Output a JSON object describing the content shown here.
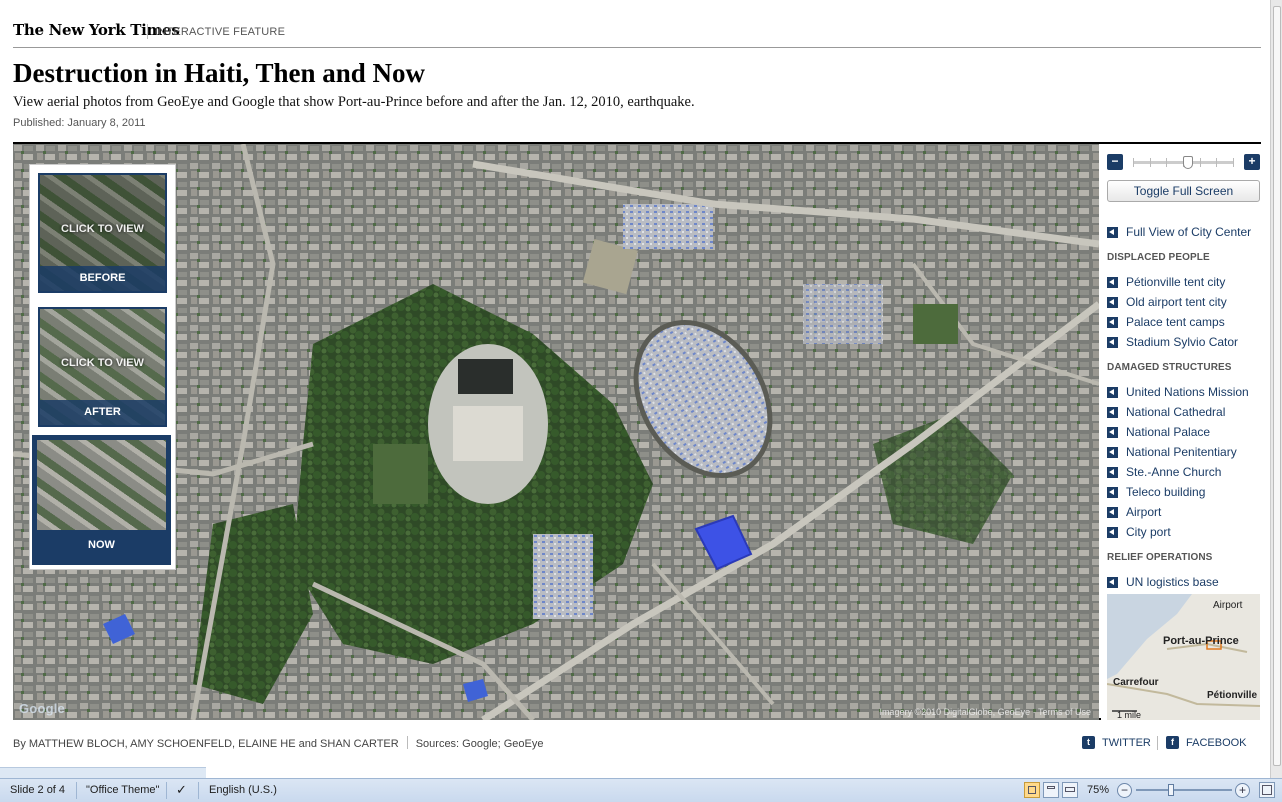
{
  "masthead": {
    "logo": "The New York Times",
    "section": "INTERACTIVE FEATURE"
  },
  "article": {
    "title": "Destruction in Haiti, Then and Now",
    "summary": "View aerial photos from GeoEye and Google that show Port-au-Prince before and after the Jan. 12, 2010, earthquake.",
    "published": "Published: January 8, 2011"
  },
  "viewer": {
    "thumbnails": [
      {
        "cta": "CLICK TO VIEW",
        "label": "BEFORE"
      },
      {
        "cta": "CLICK TO VIEW",
        "label": "AFTER"
      },
      {
        "cta": "",
        "label": "NOW"
      }
    ],
    "map_credit": "Imagery ©2010 DigitalGlobe, GeoEye · Terms of Use",
    "google_mark": "Google",
    "zoom_level": 0.55,
    "toggle_fullscreen": "Toggle Full Screen",
    "nav": {
      "full_view": "Full View of City Center",
      "groups": [
        {
          "heading": "DISPLACED PEOPLE",
          "items": [
            "Pétionville tent city",
            "Old airport tent city",
            "Palace tent camps",
            "Stadium Sylvio Cator"
          ]
        },
        {
          "heading": "DAMAGED STRUCTURES",
          "items": [
            "United Nations Mission",
            "National Cathedral",
            "National Palace",
            "National Penitentiary",
            "Ste.-Anne Church",
            "Teleco building",
            "Airport",
            "City port"
          ]
        },
        {
          "heading": "RELIEF OPERATIONS",
          "items": [
            "UN logistics base"
          ]
        }
      ]
    },
    "locator": {
      "airport": "Airport",
      "city": "Port-au-Prince",
      "carrefour": "Carrefour",
      "petionville": "Pétionville",
      "scale": "1 mile"
    }
  },
  "footer": {
    "byline": "By MATTHEW BLOCH, AMY SCHOENFELD, ELAINE HE and SHAN CARTER",
    "sources": "Sources: Google; GeoEye",
    "twitter": "TWITTER",
    "facebook": "FACEBOOK"
  },
  "statusbar": {
    "slide": "Slide 2 of 4",
    "theme": "\"Office Theme\"",
    "language": "English (U.S.)",
    "zoom": "75%",
    "minus": "−",
    "plus": "+"
  }
}
